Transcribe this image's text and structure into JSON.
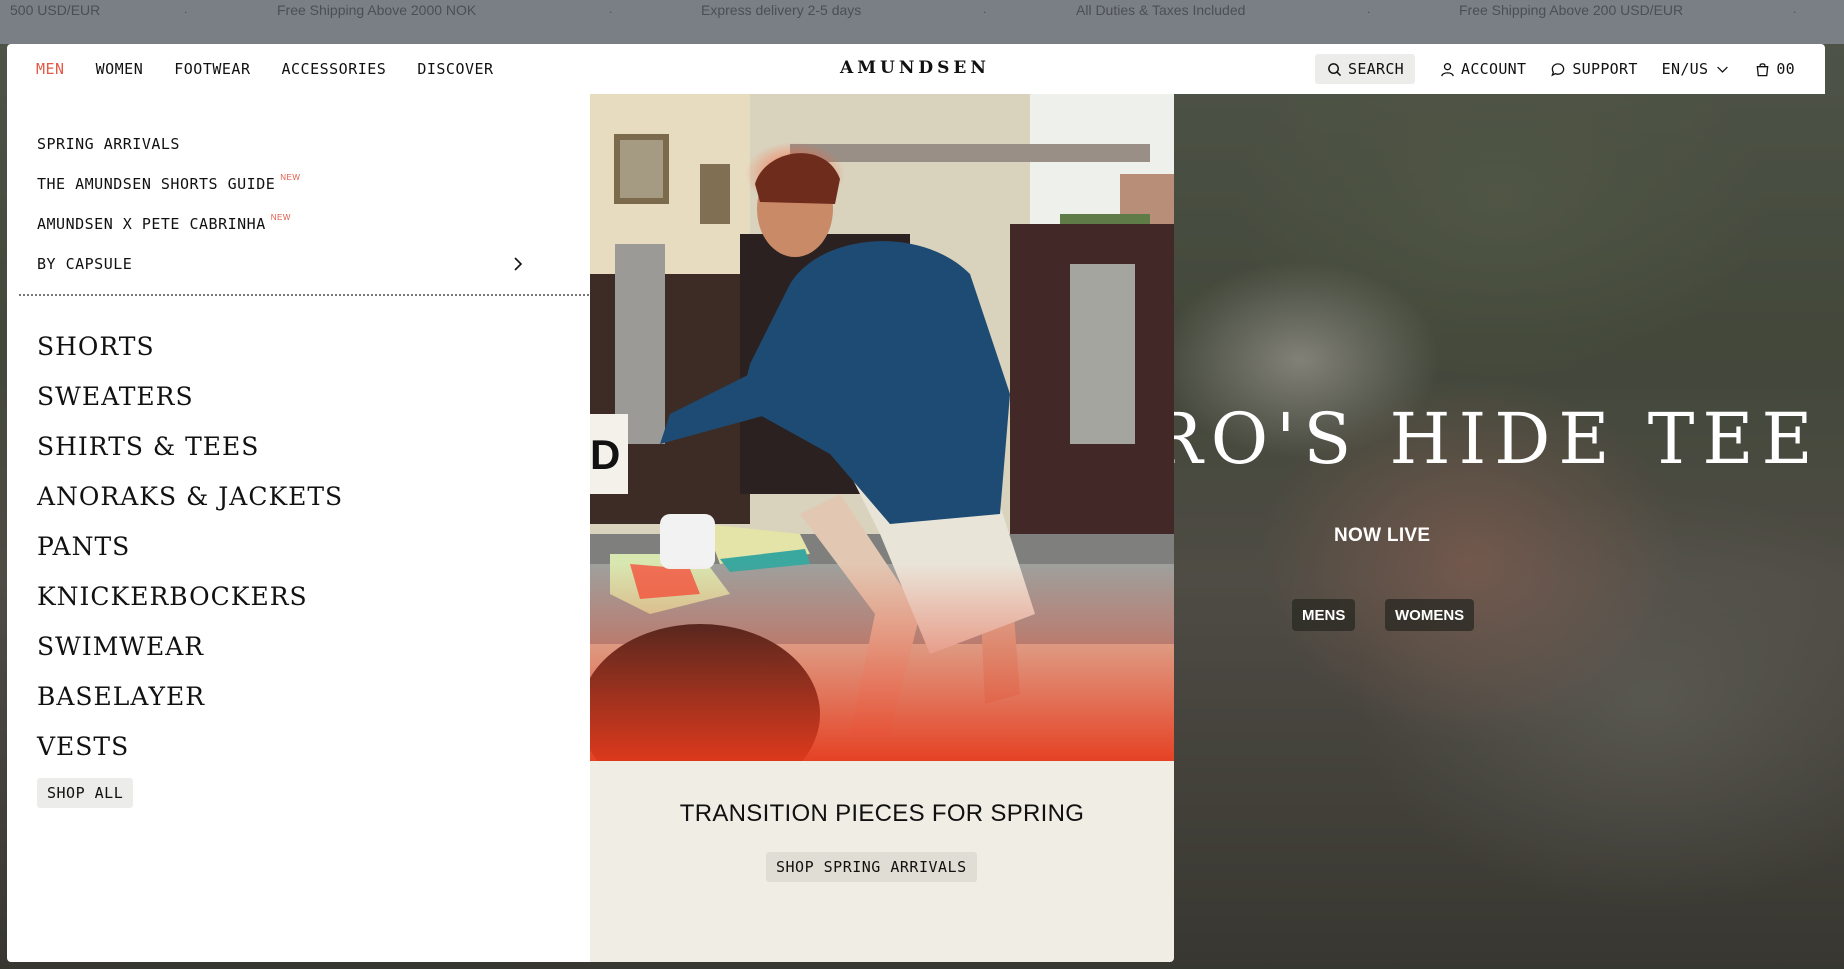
{
  "announcement": {
    "items": [
      "500 USD/EUR",
      "Free Shipping Above 2000 NOK",
      "Express delivery 2-5 days",
      "All Duties & Taxes Included",
      "Free Shipping Above 200 USD/EUR"
    ],
    "separator": "."
  },
  "nav": {
    "links": [
      "MEN",
      "WOMEN",
      "FOOTWEAR",
      "ACCESSORIES",
      "DISCOVER"
    ],
    "active": "MEN",
    "logo": "AMUNDSEN",
    "search_label": "SEARCH",
    "account_label": "ACCOUNT",
    "support_label": "SUPPORT",
    "locale_label": "EN/US",
    "cart_count": "00"
  },
  "menu": {
    "features": [
      {
        "label": "SPRING ARRIVALS",
        "badge": ""
      },
      {
        "label": "THE AMUNDSEN SHORTS GUIDE",
        "badge": "NEW"
      },
      {
        "label": "AMUNDSEN X PETE CABRINHA",
        "badge": "NEW"
      },
      {
        "label": "BY CAPSULE",
        "badge": ""
      }
    ],
    "categories": [
      "SHORTS",
      "SWEATERS",
      "SHIRTS & TEES",
      "ANORAKS & JACKETS",
      "PANTS",
      "KNICKERBOCKERS",
      "SWIMWEAR",
      "BASELAYER",
      "VESTS"
    ],
    "shop_all_label": "SHOP ALL"
  },
  "promo": {
    "title": "TRANSITION PIECES FOR SPRING",
    "button_label": "SHOP SPRING ARRIVALS",
    "plate_text": "D"
  },
  "hero": {
    "title": "RO'S HIDE TEE",
    "subtitle": "NOW LIVE",
    "buttons": [
      "MENS",
      "WOMENS"
    ]
  },
  "colors": {
    "accent": "#e35a47",
    "panel_bg": "#ffffff",
    "promo_bg": "#efede4",
    "pill_bg": "#ececea"
  },
  "icons": {
    "search": "search-icon",
    "account": "user-icon",
    "support": "chat-bubble-icon",
    "locale": "chevron-down-icon",
    "cart": "shopping-bag-icon",
    "capsule": "chevron-right-icon"
  }
}
